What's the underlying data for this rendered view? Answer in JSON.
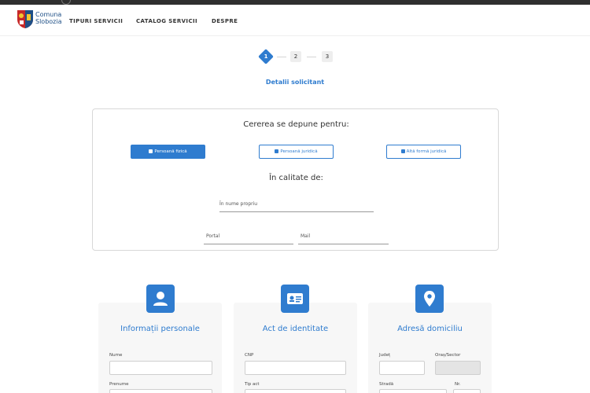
{
  "brand": {
    "line1": "Comuna",
    "line2": "Slobozia"
  },
  "nav": {
    "items": [
      "TIPURI SERVICII",
      "CATALOG SERVICII",
      "DESPRE"
    ]
  },
  "steps": {
    "items": [
      "1",
      "2",
      "3"
    ],
    "active_title": "Detalii solicitant"
  },
  "request": {
    "heading": "Cererea se depune pentru:",
    "options": [
      "Persoană fizică",
      "Persoană juridică",
      "Altă formă juridică"
    ],
    "role_heading": "În calitate de:",
    "role_value": "În nume propriu",
    "portal_label": "Portal",
    "mail_label": "Mail"
  },
  "sections": {
    "personal": {
      "title": "Informații personale",
      "name": "Nume",
      "surname": "Prenume"
    },
    "identity": {
      "title": "Act de identitate",
      "cnp": "CNP",
      "doc_type": "Tip act"
    },
    "address": {
      "title": "Adresă domiciliu",
      "county": "Județ",
      "city": "Oraș/Sector",
      "street": "Stradă",
      "number": "Nr."
    }
  },
  "colors": {
    "accent": "#2f7ccf",
    "topbar": "#2f2f2f"
  },
  "icons": {
    "personal": "user-icon",
    "identity": "id-card-icon",
    "address": "map-marker-icon"
  }
}
